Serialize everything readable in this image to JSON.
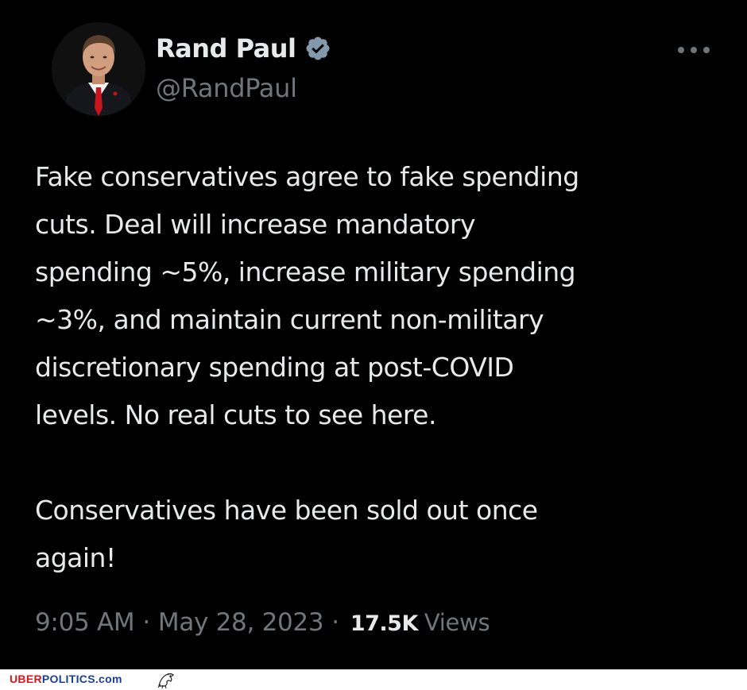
{
  "tweet": {
    "author": {
      "display_name": "Rand Paul",
      "handle": "@RandPaul",
      "verified": true
    },
    "icons": {
      "verified": "verified-badge-icon",
      "more": "more-options-icon"
    },
    "text": "Fake conservatives agree to fake spending\ncuts.  Deal will increase mandatory\nspending ~5%, increase military spending\n~3%, and maintain current non-military\ndiscretionary spending at post-COVID\nlevels. No real cuts to see here.\n\nConservatives have been sold out once\nagain!",
    "time": "9:05 AM",
    "separator": "·",
    "date": "May 28, 2023",
    "views_count": "17.5K",
    "views_label": "Views"
  },
  "watermark": {
    "part1": "UBER",
    "part2": "POLITICS.com"
  },
  "colors": {
    "background": "#000000",
    "primary_text": "#e7e9ea",
    "secondary_text": "#71767b",
    "verified_badge": "#829aab",
    "watermark_red": "#e0131a",
    "watermark_blue": "#1a3e9a"
  }
}
